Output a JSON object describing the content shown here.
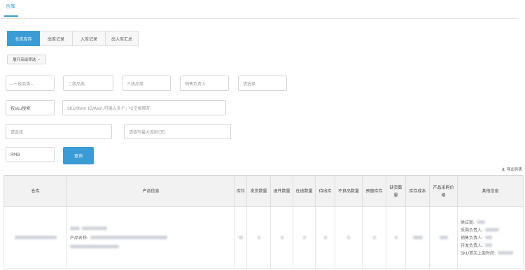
{
  "header": {
    "tab": "仓库"
  },
  "subtabs": [
    {
      "label": "仓库库存",
      "active": true
    },
    {
      "label": "出库记录",
      "active": false
    },
    {
      "label": "入库记录",
      "active": false
    },
    {
      "label": "出入库汇总",
      "active": false
    }
  ],
  "filters": {
    "advanced_toggle": "展开高级筛选",
    "category1": "--一级品类--",
    "category2": "二级品类",
    "category3": "三级品类",
    "sales_owner": "销售负责人",
    "select_a": "请选择",
    "sku_search_mode": "按sku搜索",
    "sku_search_placeholder": "SKU/Item ID/Asin,可输入多个，以空格隔开",
    "select_b": "请选择",
    "max_stock_days": "请填写最大库龄(天)",
    "currency": "RMB",
    "query_button": "查询",
    "export_label": "导出列表"
  },
  "table": {
    "headers": [
      "仓库",
      "产品信息",
      "库位",
      "发货数量",
      "退件数量",
      "在途数量",
      "待出库",
      "不良品数量",
      "预留库存",
      "缺货数量",
      "库存成本",
      "产品采购价格",
      "其他信息"
    ],
    "row": {
      "product_label": "产品名称:",
      "other_labels": [
        "供应商:",
        "采购负责人:",
        "销售负责人:",
        "开发负责人:",
        "SKU首次上架时间:"
      ]
    }
  },
  "icons": {
    "export": "download-icon",
    "dropdown": "chevron-down-icon"
  },
  "colors": {
    "accent": "#3a9bd5"
  }
}
